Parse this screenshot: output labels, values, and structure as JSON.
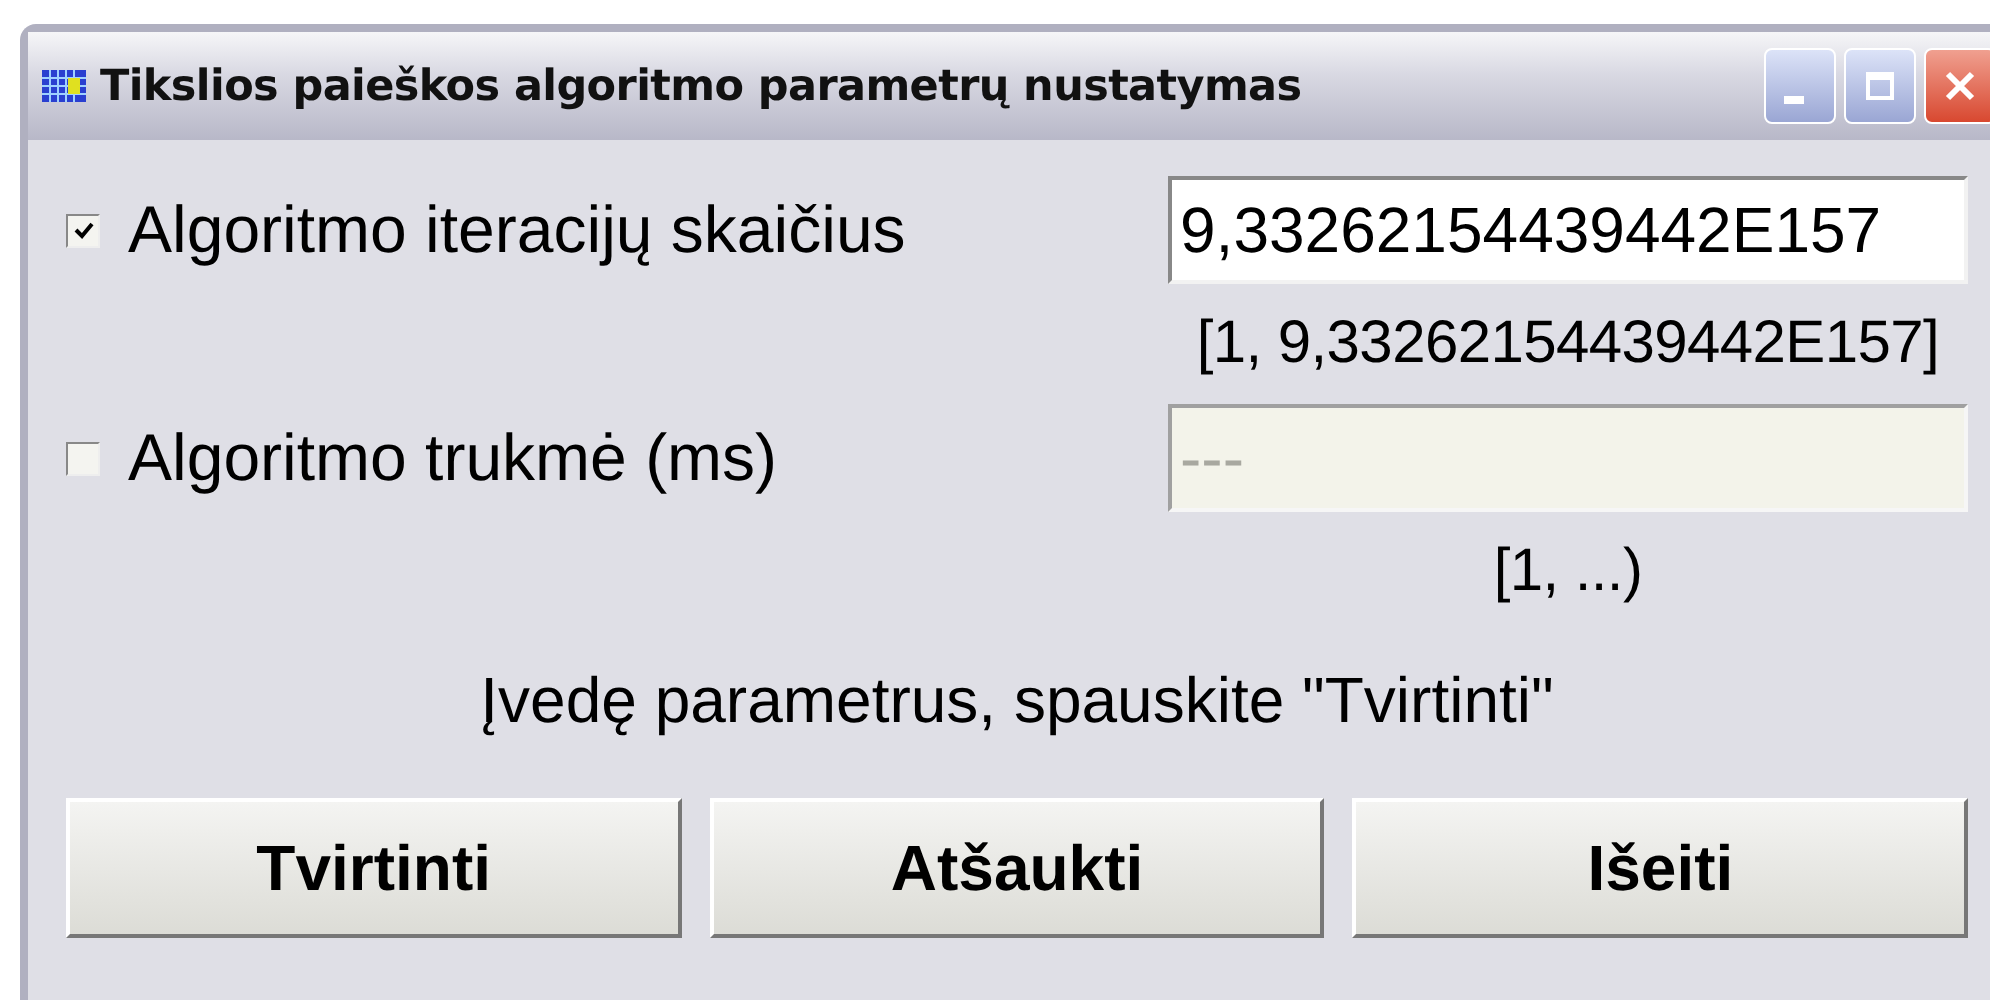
{
  "window": {
    "title": "Tikslios paieškos algoritmo parametrų nustatymas"
  },
  "rows": [
    {
      "label": "Algoritmo iteracijų skaičius",
      "checked": true,
      "field": {
        "value": "9,33262154439442E157",
        "disabled": false
      },
      "range": "[1, 9,33262154439442E157]"
    },
    {
      "label": "Algoritmo trukmė (ms)",
      "checked": false,
      "field": {
        "placeholder": "---",
        "disabled": true
      },
      "range": "[1, ...)"
    }
  ],
  "message": "Įvedę parametrus, spauskite \"Tvirtinti\"",
  "buttons": [
    "Tvirtinti",
    "Atšaukti",
    "Išeiti"
  ]
}
